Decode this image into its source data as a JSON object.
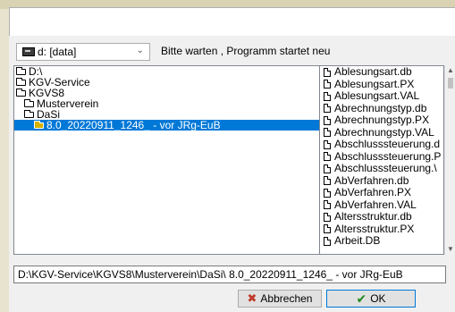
{
  "drive_selector": {
    "value": "d: [data]"
  },
  "status": "Bitte warten , Programm startet neu",
  "directories": [
    {
      "label": "D:\\",
      "selected": false
    },
    {
      "label": "KGV-Service",
      "selected": false
    },
    {
      "label": "KGVS8",
      "selected": false
    },
    {
      "label": "Musterverein",
      "selected": false
    },
    {
      "label": "DaSi",
      "selected": false
    },
    {
      "label": "8.0_20220911_1246_ - vor JRg-EuB",
      "selected": true
    }
  ],
  "files": [
    "Ablesungsart.db",
    "Ablesungsart.PX",
    "Ablesungsart.VAL",
    "Abrechnungstyp.db",
    "Abrechnungstyp.PX",
    "Abrechnungstyp.VAL",
    "Abschlusssteuerung.d",
    "Abschlusssteuerung.P",
    "Abschlusssteuerung.\\",
    "AbVerfahren.db",
    "AbVerfahren.PX",
    "AbVerfahren.VAL",
    "Altersstruktur.db",
    "Altersstruktur.PX",
    "Arbeit.DB"
  ],
  "path": "D:\\KGV-Service\\KGVS8\\Musterverein\\DaSi\\ 8.0_20220911_1246_ - vor JRg-EuB",
  "buttons": {
    "cancel": "Abbrechen",
    "ok": "OK"
  },
  "colors": {
    "selection": "#0078d7",
    "ok_border": "#0078d7"
  }
}
